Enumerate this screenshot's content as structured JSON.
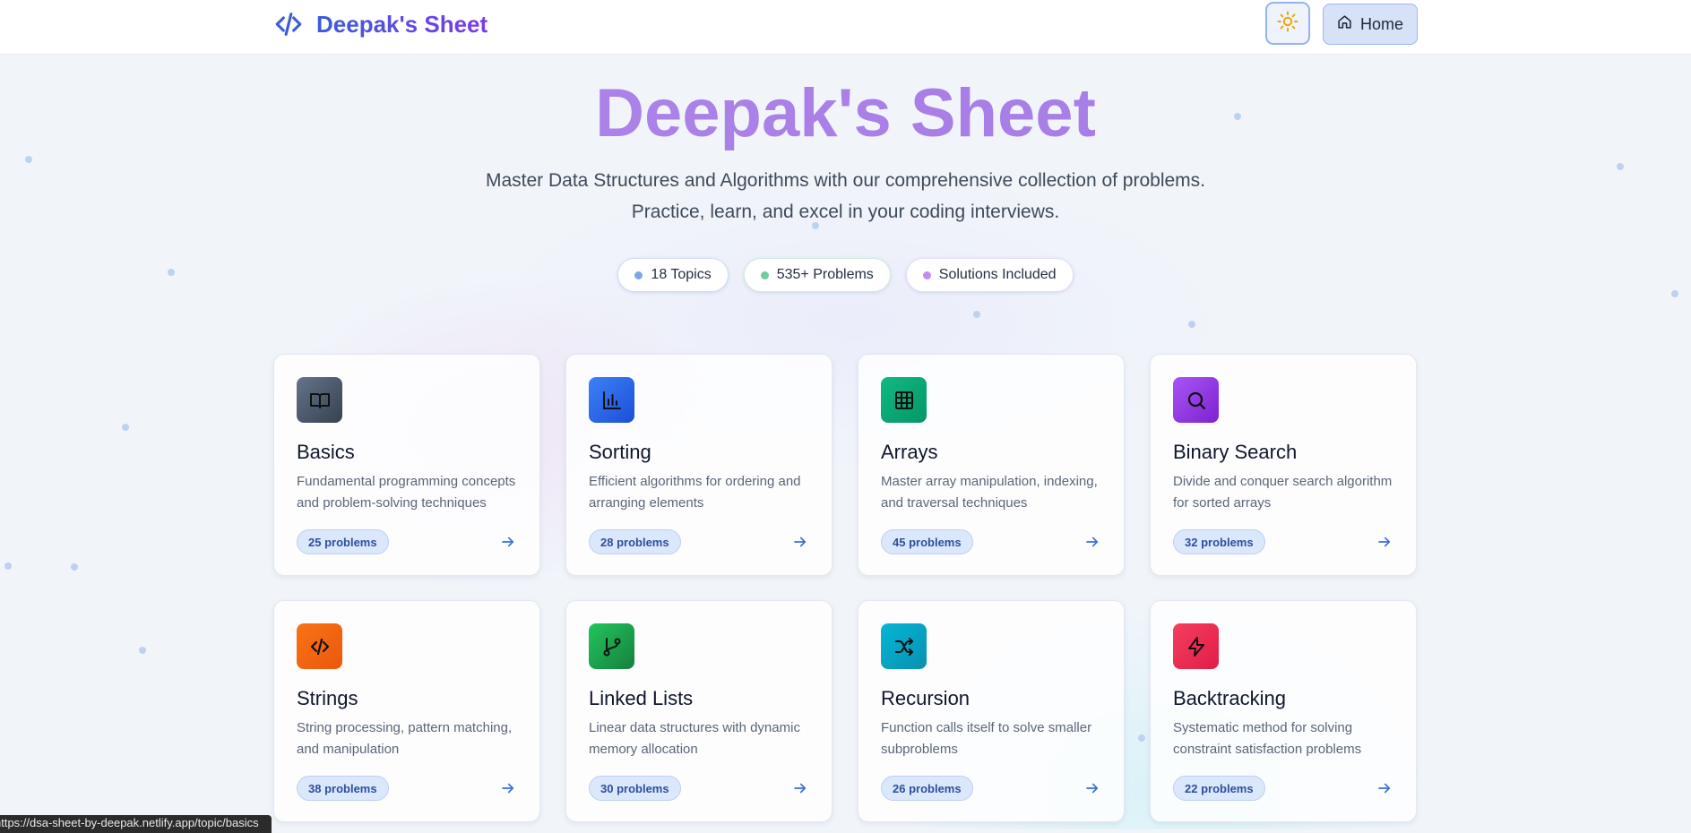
{
  "header": {
    "brand": "Deepak's Sheet",
    "home_label": "Home"
  },
  "hero": {
    "title": "Deepak's Sheet",
    "subtitle_line1": "Master Data Structures and Algorithms with our comprehensive collection of problems.",
    "subtitle_line2": "Practice, learn, and excel in your coding interviews."
  },
  "stats": [
    {
      "label": "18 Topics",
      "color": "#7fa4ea"
    },
    {
      "label": "535+ Problems",
      "color": "#6fce9b"
    },
    {
      "label": "Solutions Included",
      "color": "#c08ef0"
    }
  ],
  "topics": [
    {
      "title": "Basics",
      "description": "Fundamental programming concepts and problem-solving techniques",
      "count": "25 problems",
      "icon": "book-open-icon",
      "color": "#4b5563"
    },
    {
      "title": "Sorting",
      "description": "Efficient algorithms for ordering and arranging elements",
      "count": "28 problems",
      "icon": "bar-chart-icon",
      "color": "#2f6ef5"
    },
    {
      "title": "Arrays",
      "description": "Master array manipulation, indexing, and traversal techniques",
      "count": "45 problems",
      "icon": "grid-icon",
      "color": "#10a86a"
    },
    {
      "title": "Binary Search",
      "description": "Divide and conquer search algorithm for sorted arrays",
      "count": "32 problems",
      "icon": "search-icon",
      "color": "#9b4df2"
    },
    {
      "title": "Strings",
      "description": "String processing, pattern matching, and manipulation",
      "count": "38 problems",
      "icon": "code-icon",
      "color": "#f06a14"
    },
    {
      "title": "Linked Lists",
      "description": "Linear data structures with dynamic memory allocation",
      "count": "30 problems",
      "icon": "git-branch-icon",
      "color": "#17ad55"
    },
    {
      "title": "Recursion",
      "description": "Function calls itself to solve smaller subproblems",
      "count": "26 problems",
      "icon": "shuffle-icon",
      "color": "#0ea5bf"
    },
    {
      "title": "Backtracking",
      "description": "Systematic method for solving constraint satisfaction problems",
      "count": "22 problems",
      "icon": "zap-icon",
      "color": "#e8234d"
    }
  ],
  "status_bar": {
    "url": "https://dsa-sheet-by-deepak.netlify.app/topic/basics"
  }
}
